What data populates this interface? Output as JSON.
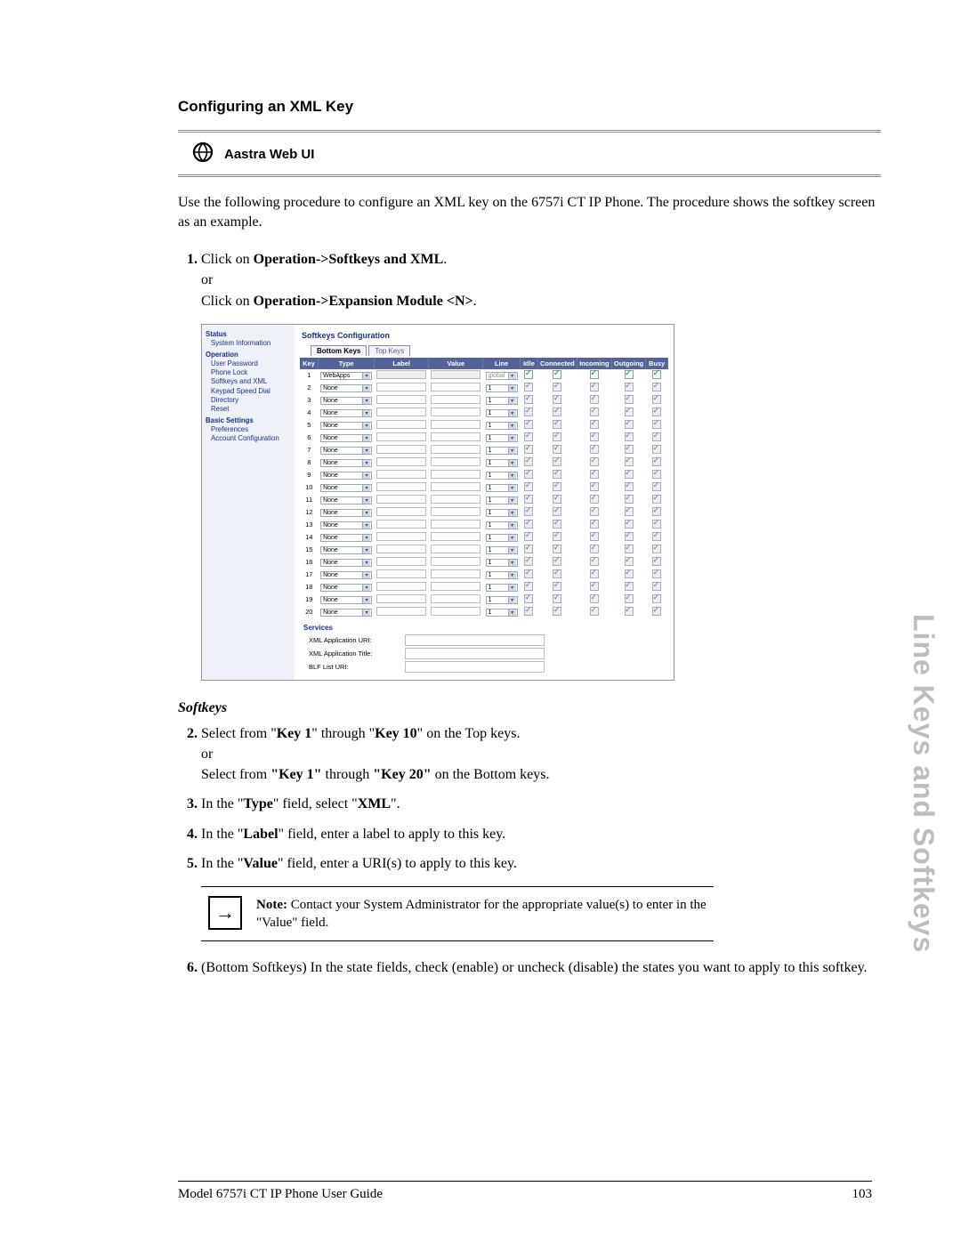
{
  "side_tab": "Line Keys and Softkeys",
  "heading": "Configuring an XML Key",
  "banner_title": "Aastra Web UI",
  "intro": "Use the following procedure to configure an XML key on the 6757i CT IP Phone. The procedure shows the softkey screen as an example.",
  "step1_a": "Click on ",
  "step1_b": "Operation->Softkeys and XML",
  "step1_or": "or",
  "step1_c": "Click on ",
  "step1_d": "Operation->Expansion Module <N>",
  "softkeys_heading": "Softkeys",
  "step2_a": "Select from \"",
  "step2_key1": "Key 1",
  "step2_thru": "\" through \"",
  "step2_key10": "Key 10",
  "step2_top": "\" on the Top keys.",
  "step2_or": "or",
  "step2_b": "Select from ",
  "step2_b_key1": "\"Key 1\"",
  "step2_b_thru": " through ",
  "step2_b_key20": "\"Key 20\"",
  "step2_bot": " on the Bottom keys.",
  "step3_a": "In the \"",
  "step3_type": "Type",
  "step3_b": "\" field, select \"",
  "step3_xml": "XML",
  "step3_c": "\".",
  "step4_a": "In the \"",
  "step4_label": "Label",
  "step4_b": "\" field, enter a label to apply to this key.",
  "step5_a": "In the \"",
  "step5_value": "Value",
  "step5_b": "\" field, enter a URI(s) to apply to this key.",
  "note_label": "Note:",
  "note_text": " Contact your System Administrator for the appropriate value(s) to enter in the \"Value\" field.",
  "step6": "(Bottom Softkeys) In the state fields, check (enable) or uncheck (disable) the states you want to apply to this softkey.",
  "footer_left": "Model 6757i CT IP Phone User Guide",
  "footer_right": "103",
  "ui": {
    "nav": {
      "status": "Status",
      "sysinfo": "System Information",
      "operation": "Operation",
      "userpw": "User Password",
      "phonelock": "Phone Lock",
      "softxml": "Softkeys and XML",
      "keypad": "Keypad Speed Dial",
      "directory": "Directory",
      "reset": "Reset",
      "basic": "Basic Settings",
      "prefs": "Preferences",
      "acct": "Account Configuration"
    },
    "title": "Softkeys Configuration",
    "tab_bottom": "Bottom Keys",
    "tab_top": "Top Keys",
    "headers": {
      "key": "Key",
      "type": "Type",
      "label": "Label",
      "value": "Value",
      "line": "Line",
      "idle": "Idle",
      "connected": "Connected",
      "incoming": "Incoming",
      "outgoing": "Outgoing",
      "busy": "Busy"
    },
    "row1_type": "WebApps",
    "row1_line": "global",
    "rest_type": "None",
    "rest_line": "1",
    "services": "Services",
    "svc1": "XML Application URI:",
    "svc2": "XML Application Title:",
    "svc3": "BLF List URI:"
  }
}
